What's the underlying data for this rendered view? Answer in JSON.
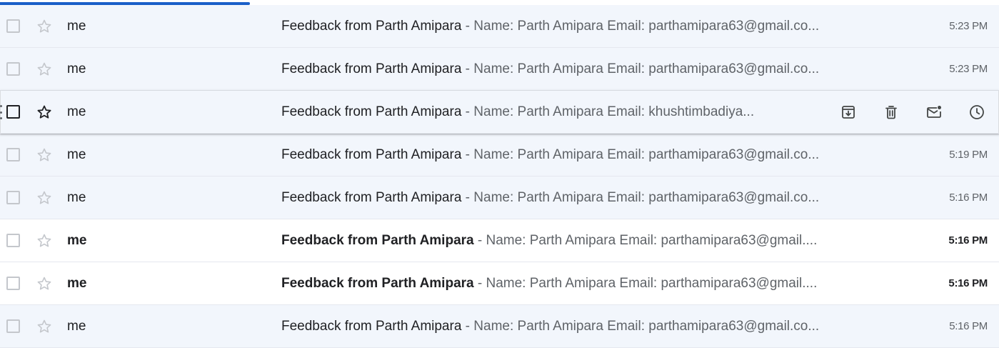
{
  "loading_progress": 0.25,
  "colors": {
    "progress": "#1a5fc8",
    "read_row_bg": "#f2f6fc",
    "unread_row_bg": "#ffffff",
    "text_primary": "#202124",
    "text_secondary": "#5f6368"
  },
  "emails": [
    {
      "sender": "me",
      "subject": "Feedback from Parth Amipara",
      "separator": " - ",
      "snippet": "Name: Parth Amipara Email: parthamipara63@gmail.co...",
      "time": "5:23 PM",
      "read": true
    },
    {
      "sender": "me",
      "subject": "Feedback from Parth Amipara",
      "separator": " - ",
      "snippet": "Name: Parth Amipara Email: parthamipara63@gmail.co...",
      "time": "5:23 PM",
      "read": true
    },
    {
      "sender": "me",
      "subject": "Feedback from Parth Amipara",
      "separator": " - ",
      "snippet": "Name: Parth Amipara Email: khushtimbadiya...",
      "time": "",
      "read": true,
      "hovered": true
    },
    {
      "sender": "me",
      "subject": "Feedback from Parth Amipara",
      "separator": " - ",
      "snippet": "Name: Parth Amipara Email: parthamipara63@gmail.co...",
      "time": "5:19 PM",
      "read": true
    },
    {
      "sender": "me",
      "subject": "Feedback from Parth Amipara",
      "separator": " - ",
      "snippet": "Name: Parth Amipara Email: parthamipara63@gmail.co...",
      "time": "5:16 PM",
      "read": true
    },
    {
      "sender": "me",
      "subject": "Feedback from Parth Amipara",
      "separator": " - ",
      "snippet": "Name: Parth Amipara Email: parthamipara63@gmail....",
      "time": "5:16 PM",
      "read": false
    },
    {
      "sender": "me",
      "subject": "Feedback from Parth Amipara",
      "separator": " - ",
      "snippet": "Name: Parth Amipara Email: parthamipara63@gmail....",
      "time": "5:16 PM",
      "read": false
    },
    {
      "sender": "me",
      "subject": "Feedback from Parth Amipara",
      "separator": " - ",
      "snippet": "Name: Parth Amipara Email: parthamipara63@gmail.co...",
      "time": "5:16 PM",
      "read": true
    }
  ],
  "hover_actions": [
    {
      "name": "archive-icon"
    },
    {
      "name": "delete-icon"
    },
    {
      "name": "mark-as-unread-icon"
    },
    {
      "name": "snooze-icon"
    }
  ]
}
